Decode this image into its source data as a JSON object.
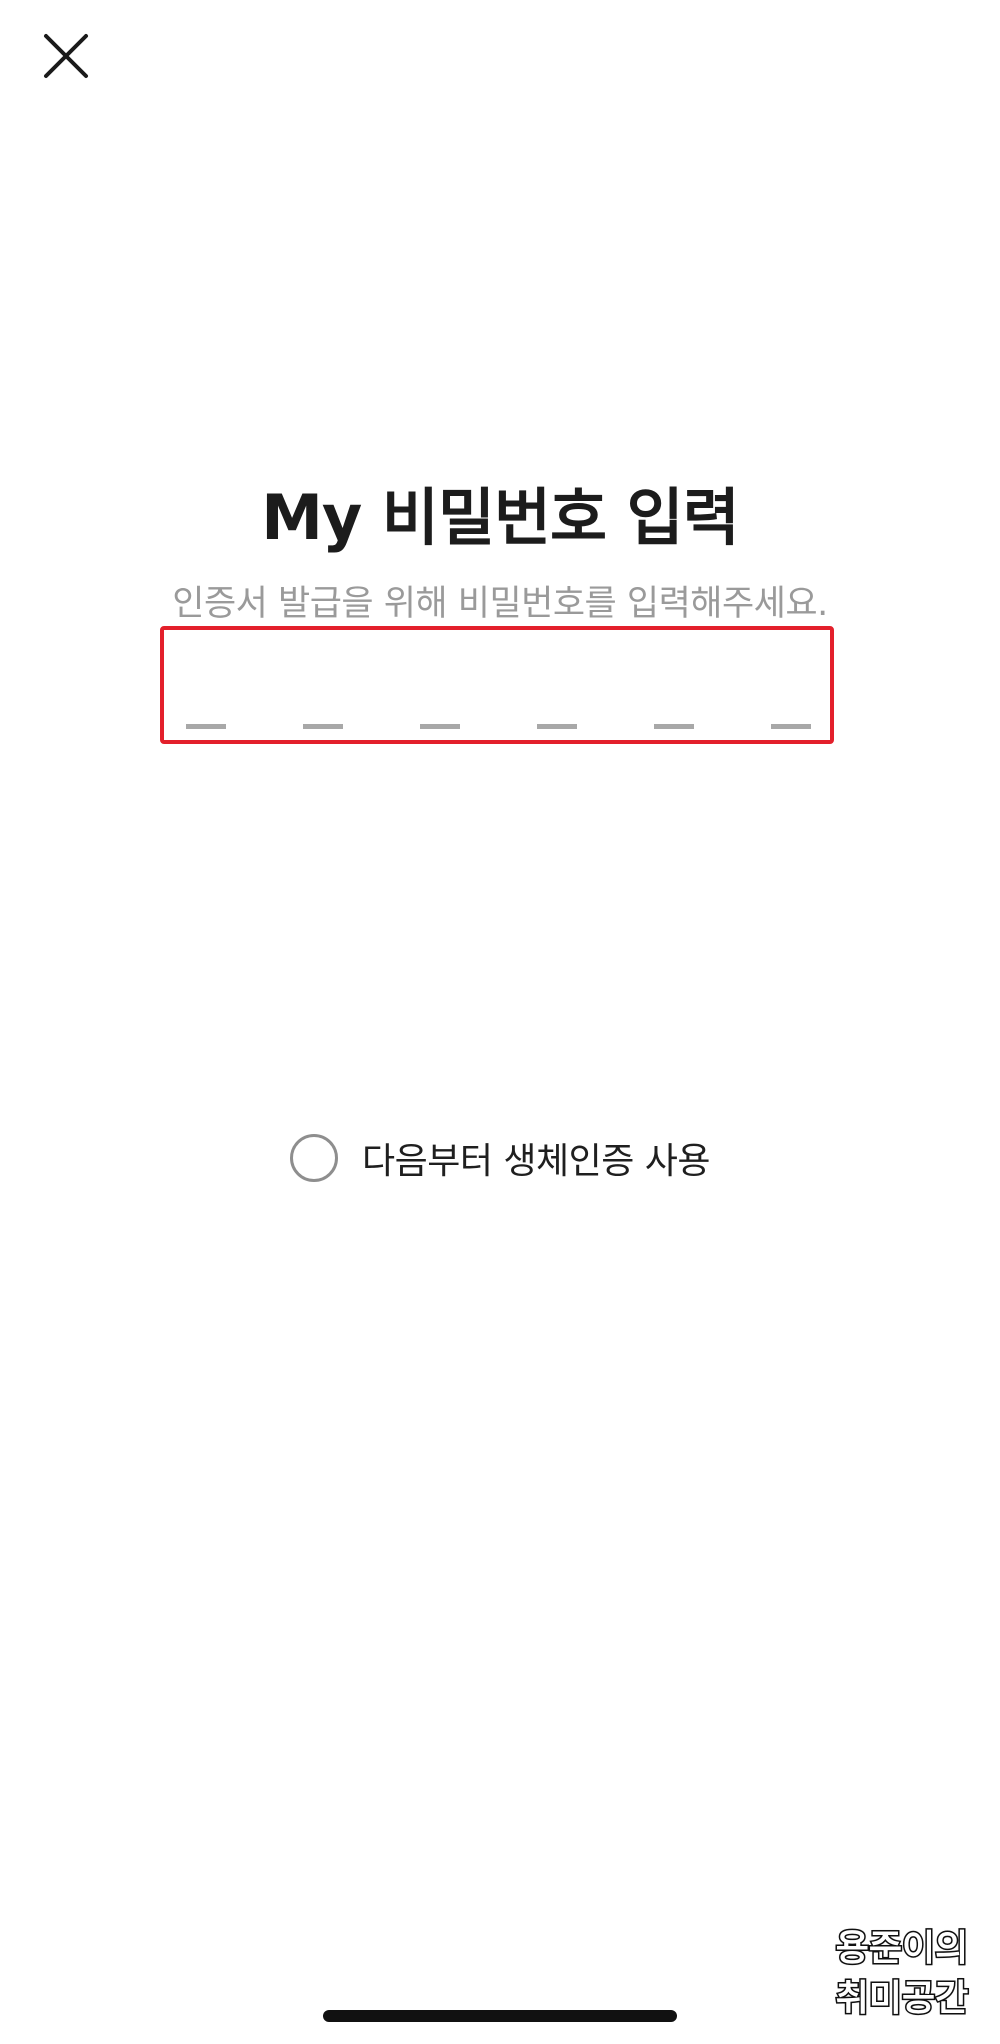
{
  "header": {
    "close_icon": "close-icon"
  },
  "main": {
    "title": "My 비밀번호 입력",
    "subtitle": "인증서 발급을 위해 비밀번호를 입력해주세요.",
    "pin": {
      "length": 6,
      "entered": 0,
      "highlight_color": "#e3202b"
    }
  },
  "biometric": {
    "label": "다음부터 생체인증 사용",
    "checked": false
  },
  "watermark": {
    "line1": "용준이의",
    "line2": "취미공간"
  }
}
